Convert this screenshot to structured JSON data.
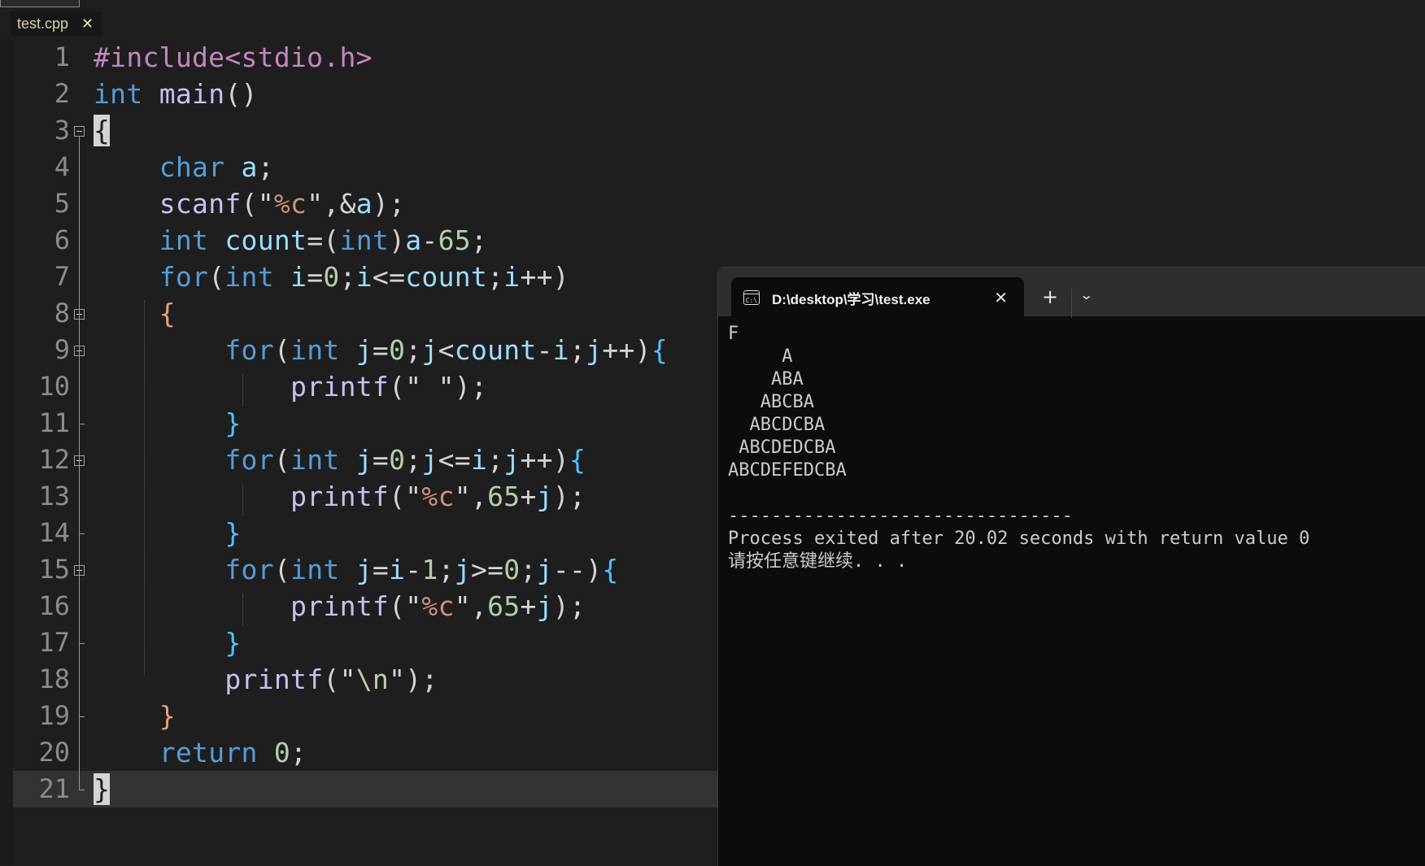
{
  "editor": {
    "tab": {
      "filename": "test.cpp",
      "close_glyph": "✕"
    },
    "current_line": 21,
    "lines": [
      {
        "n": "1"
      },
      {
        "n": "2"
      },
      {
        "n": "3"
      },
      {
        "n": "4"
      },
      {
        "n": "5"
      },
      {
        "n": "6"
      },
      {
        "n": "7"
      },
      {
        "n": "8"
      },
      {
        "n": "9"
      },
      {
        "n": "10"
      },
      {
        "n": "11"
      },
      {
        "n": "12"
      },
      {
        "n": "13"
      },
      {
        "n": "14"
      },
      {
        "n": "15"
      },
      {
        "n": "16"
      },
      {
        "n": "17"
      },
      {
        "n": "18"
      },
      {
        "n": "19"
      },
      {
        "n": "20"
      },
      {
        "n": "21"
      }
    ],
    "source": [
      "#include<stdio.h>",
      "int main()",
      "{",
      "    char a;",
      "    scanf(\"%c\",&a);",
      "    int count=(int)a-65;",
      "    for(int i=0;i<=count;i++)",
      "    {",
      "        for(int j=0;j<count-i;j++){",
      "            printf(\" \");",
      "        }",
      "        for(int j=0;j<=i;j++){",
      "            printf(\"%c\",65+j);",
      "        }",
      "        for(int j=i-1;j>=0;j--){",
      "            printf(\"%c\",65+j);",
      "        }",
      "        printf(\"\\n\");",
      "    }",
      "    return 0;",
      "}"
    ]
  },
  "terminal": {
    "tab_title": "D:\\desktop\\学习\\test.exe",
    "icon": "cmd-icon",
    "icon_text": "C:\\",
    "close_glyph": "✕",
    "new_tab_glyph": "+",
    "dropdown_glyph": "⌄",
    "output_lines": [
      "F",
      "     A",
      "    ABA",
      "   ABCBA",
      "  ABCDCBA",
      " ABCDEDCBA",
      "ABCDEFEDCBA",
      "",
      "--------------------------------",
      "Process exited after 20.02 seconds with return value 0",
      "请按任意键继续. . ."
    ]
  },
  "colors": {
    "editor_bg": "#1e1e1e",
    "keyword": "#569cd6",
    "function": "#c8c0f0",
    "variable": "#9cdcfe",
    "number": "#b5cea8",
    "string": "#ce9178",
    "preprocessor": "#c586c0",
    "terminal_bg": "#0c0c0c"
  }
}
